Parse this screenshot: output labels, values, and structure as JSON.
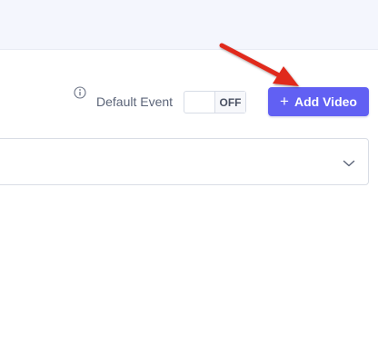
{
  "toolbar": {
    "info_icon": "info-circle-icon",
    "default_event_label": "Default Event",
    "toggle_state": "OFF",
    "add_video_label": "Add Video",
    "add_video_icon": "plus-icon"
  },
  "dropdown": {
    "icon": "chevron-down-icon"
  },
  "colors": {
    "accent": "#6160f3",
    "annotation_arrow": "#e02a1f",
    "header_band": "#f4f6fd"
  }
}
